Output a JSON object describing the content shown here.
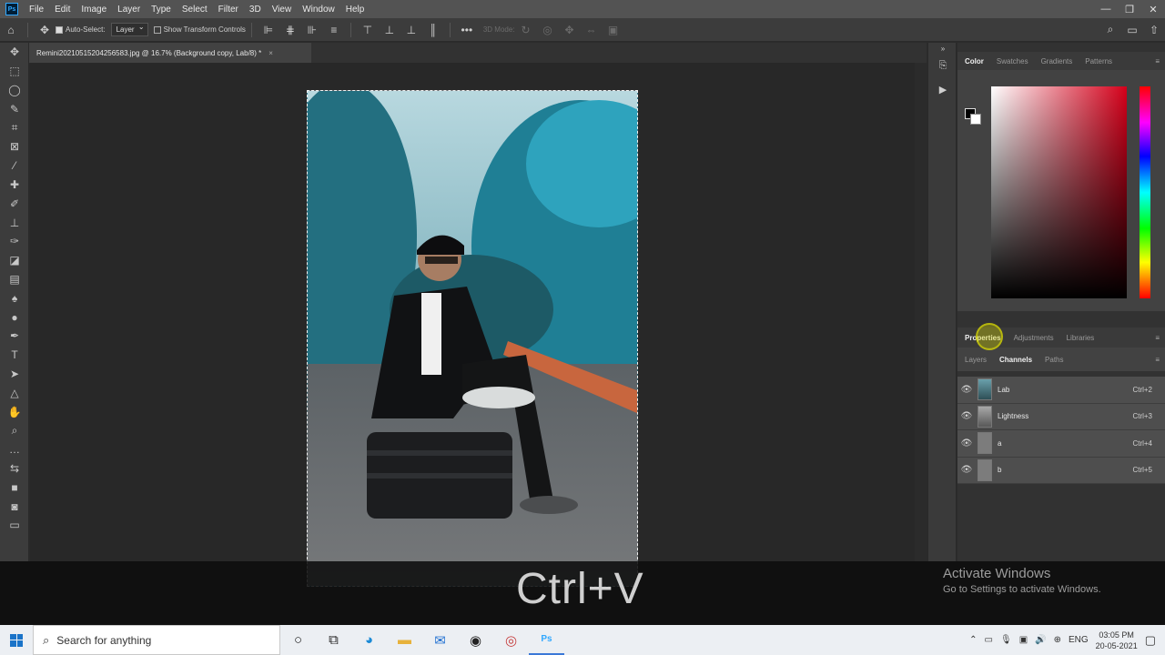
{
  "menubar": {
    "logo": "Ps",
    "items": [
      "File",
      "Edit",
      "Image",
      "Layer",
      "Type",
      "Select",
      "Filter",
      "3D",
      "View",
      "Window",
      "Help"
    ],
    "window_controls": [
      "—",
      "❐",
      "✕"
    ]
  },
  "options": {
    "auto_select_label": "Auto-Select:",
    "auto_select_value": "Layer",
    "show_transform_label": "Show Transform Controls",
    "three_d_mode": "3D Mode:"
  },
  "document": {
    "tab_title": "Remini20210515204256583.jpg @ 16.7% (Background copy, Lab/8) *",
    "close": "×"
  },
  "color_panel": {
    "tabs": [
      "Color",
      "Swatches",
      "Gradients",
      "Patterns"
    ],
    "active_tab": "Color"
  },
  "properties_panel": {
    "tabs": [
      "Properties",
      "Adjustments",
      "Libraries"
    ],
    "active_tab": "Properties"
  },
  "channels_panel": {
    "tabs": [
      "Layers",
      "Channels",
      "Paths"
    ],
    "active_tab": "Channels",
    "rows": [
      {
        "name": "Lab",
        "shortcut": "Ctrl+2",
        "thumb": "color"
      },
      {
        "name": "Lightness",
        "shortcut": "Ctrl+3",
        "thumb": "gray"
      },
      {
        "name": "a",
        "shortcut": "Ctrl+4",
        "thumb": "flat"
      },
      {
        "name": "b",
        "shortcut": "Ctrl+5",
        "thumb": "flat"
      }
    ]
  },
  "overlay": {
    "shortcut_text": "Ctrl+V",
    "activate_title": "Activate Windows",
    "activate_sub": "Go to Settings to activate Windows."
  },
  "taskbar": {
    "search_placeholder": "Search for anything",
    "language": "ENG",
    "time": "03:05 PM",
    "date": "20-05-2021"
  },
  "colors": {
    "accent": "#31a8ff",
    "panel_bg": "#323232",
    "menubar_bg": "#535353"
  }
}
